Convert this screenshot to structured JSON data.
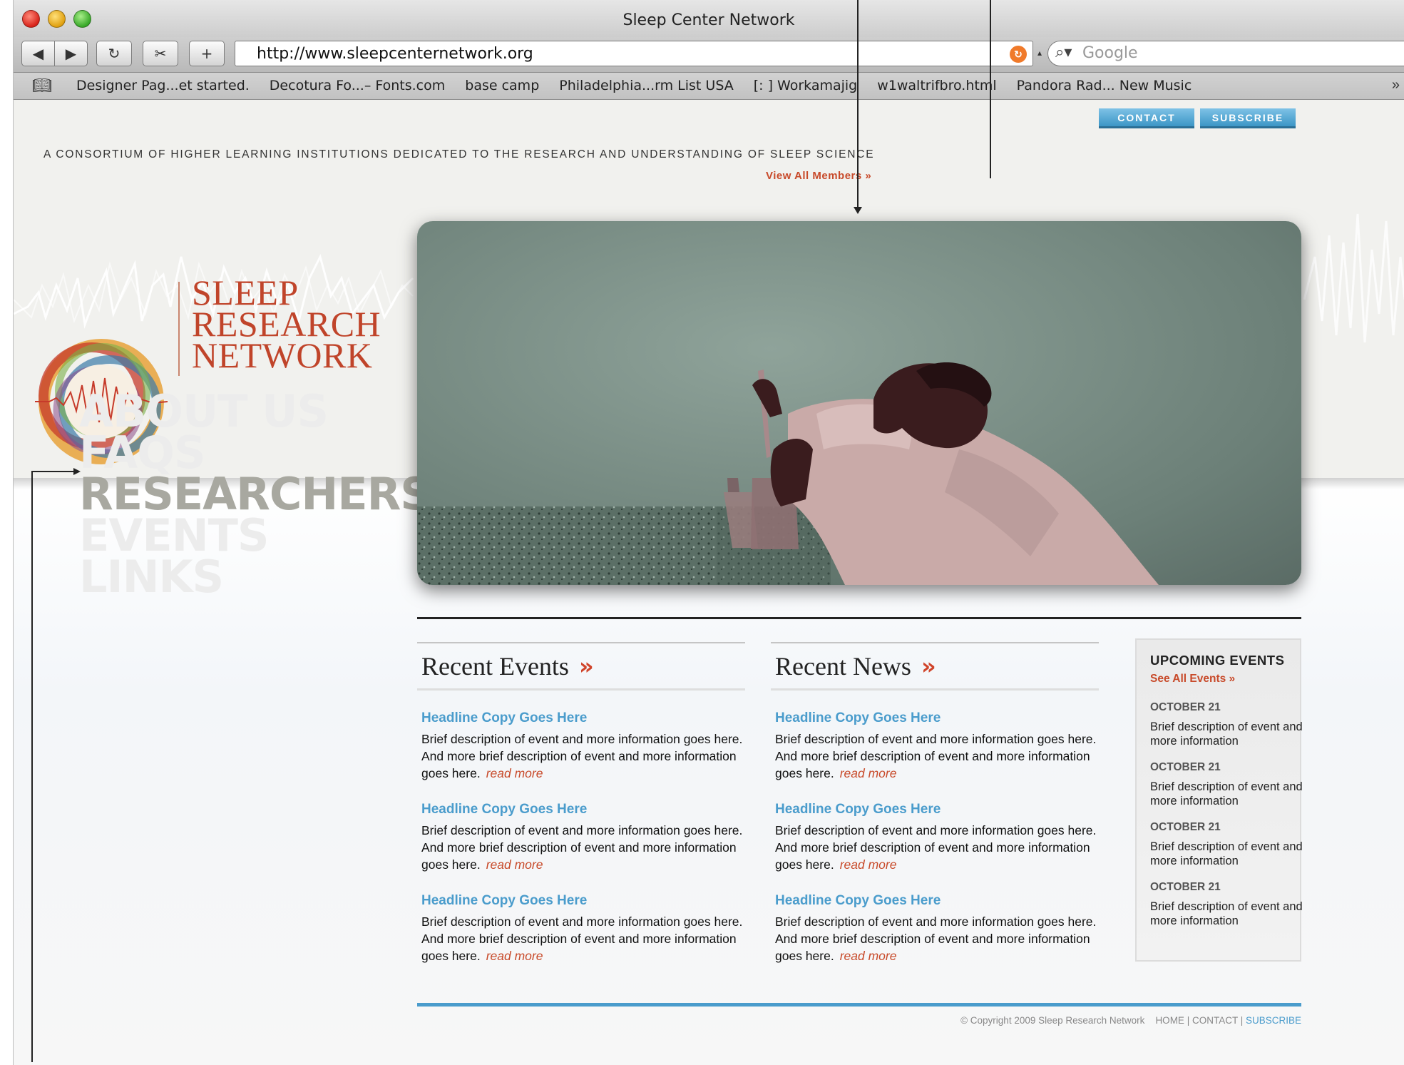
{
  "browser": {
    "window_title": "Sleep Center Network",
    "url": "http://www.sleepcenternetwork.org",
    "search_placeholder": "Google",
    "bookmarks": [
      "Designer Pag...et started.",
      "Decotura Fo...– Fonts.com",
      "base camp",
      "Philadelphia...rm List USA",
      "[: ] Workamajig",
      "w1waltrifbro.html",
      "Pandora Rad... New Music"
    ],
    "overflow_glyph": "»"
  },
  "header": {
    "contact_label": "CONTACT",
    "subscribe_label": "SUBSCRIBE",
    "tagline": "A CONSORTIUM OF HIGHER LEARNING INSTITUTIONS DEDICATED TO THE RESEARCH AND UNDERSTANDING OF SLEEP SCIENCE",
    "view_members": "View All Members »"
  },
  "logo": {
    "line1": "SLEEP",
    "line2": "RESEARCH",
    "line3": "NETWORK"
  },
  "nav": {
    "items": [
      "ABOUT US",
      "FAQS",
      "RESEARCHERS",
      "EVENTS",
      "LINKS"
    ],
    "active_index": 2
  },
  "recent_events": {
    "title": "Recent Events",
    "chevron": "»",
    "items": [
      {
        "headline": "Headline Copy Goes Here",
        "body": "Brief description of event and more information goes here. And more brief description of event and more information goes here.",
        "read_more": "read more"
      },
      {
        "headline": "Headline Copy Goes Here",
        "body": "Brief description of event and more information goes here. And more brief description of event and more information goes here.",
        "read_more": "read more"
      },
      {
        "headline": "Headline Copy Goes Here",
        "body": "Brief description of event and more information goes here. And more brief description of event and more information goes here.",
        "read_more": "read more"
      }
    ]
  },
  "recent_news": {
    "title": "Recent News",
    "chevron": "»",
    "items": [
      {
        "headline": "Headline Copy Goes Here",
        "body": "Brief description of event and more information goes here. And more brief description of event and more information goes here.",
        "read_more": "read more"
      },
      {
        "headline": "Headline Copy Goes Here",
        "body": "Brief description of event and more information goes here. And more brief description of event and more information goes here.",
        "read_more": "read more"
      },
      {
        "headline": "Headline Copy Goes Here",
        "body": "Brief description of event and more information goes here. And more brief description of event and more information goes here.",
        "read_more": "read more"
      }
    ]
  },
  "upcoming": {
    "title": "UPCOMING EVENTS",
    "see_all": "See All Events »",
    "items": [
      {
        "date": "OCTOBER 21",
        "desc": "Brief description of event and more information"
      },
      {
        "date": "OCTOBER 21",
        "desc": "Brief description of event and more information"
      },
      {
        "date": "OCTOBER 21",
        "desc": "Brief description of event and more information"
      },
      {
        "date": "OCTOBER 21",
        "desc": "Brief description of event and more information"
      }
    ]
  },
  "footer": {
    "copyright": "© Copyright 2009 Sleep Research Network",
    "home": "HOME",
    "contact": "CONTACT",
    "subscribe": "SUBSCRIBE",
    "separator": " | "
  },
  "colors": {
    "accent_blue": "#4a9ccc",
    "accent_red": "#c84a2a",
    "logo_red": "#c0442a",
    "nav_inactive": "#ececec",
    "nav_active": "#a8a8a0"
  },
  "icons": {
    "back": "back-arrow-icon",
    "forward": "forward-arrow-icon",
    "reload": "reload-icon",
    "snip": "web-clip-icon",
    "add": "add-tab-icon",
    "rss": "rss-icon",
    "search": "magnifier-icon",
    "bookmarks": "book-icon"
  }
}
